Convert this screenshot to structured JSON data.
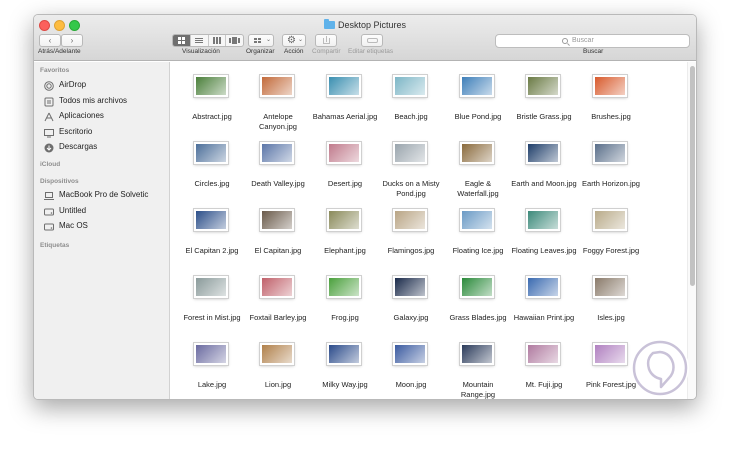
{
  "window": {
    "title": "Desktop Pictures",
    "nav_label": "Atrás/Adelante",
    "toolbar": {
      "view_label": "Visualización",
      "arrange_label": "Organizar",
      "action_label": "Acción",
      "share_label": "Compartir",
      "tags_label": "Editar etiquetas",
      "search_label": "Buscar",
      "search_placeholder": "Buscar"
    }
  },
  "sidebar": {
    "favorites_header": "Favoritos",
    "favorites": [
      {
        "label": "AirDrop",
        "icon": "airdrop-icon"
      },
      {
        "label": "Todos mis archivos",
        "icon": "all-files-icon"
      },
      {
        "label": "Aplicaciones",
        "icon": "applications-icon"
      },
      {
        "label": "Escritorio",
        "icon": "desktop-icon"
      },
      {
        "label": "Descargas",
        "icon": "downloads-icon"
      }
    ],
    "icloud_header": "iCloud",
    "devices_header": "Dispositivos",
    "devices": [
      {
        "label": "MacBook Pro de Solvetic",
        "icon": "laptop-icon"
      },
      {
        "label": "Untitled",
        "icon": "disk-icon"
      },
      {
        "label": "Mac OS",
        "icon": "disk-icon"
      }
    ],
    "tags_header": "Etiquetas"
  },
  "files": [
    {
      "name": "Abstract.jpg",
      "color": "#4a7f3a"
    },
    {
      "name": "Antelope Canyon.jpg",
      "color": "#c26a3a"
    },
    {
      "name": "Bahamas Aerial.jpg",
      "color": "#3a8fb0"
    },
    {
      "name": "Beach.jpg",
      "color": "#7db6c6"
    },
    {
      "name": "Blue Pond.jpg",
      "color": "#3e7fb9"
    },
    {
      "name": "Bristle Grass.jpg",
      "color": "#6a7a44"
    },
    {
      "name": "Brushes.jpg",
      "color": "#d85a2c"
    },
    {
      "name": "Circles.jpg",
      "color": "#4c6f9a"
    },
    {
      "name": "Death Valley.jpg",
      "color": "#5b76a8"
    },
    {
      "name": "Desert.jpg",
      "color": "#c07a8c"
    },
    {
      "name": "Ducks on a Misty Pond.jpg",
      "color": "#9aa5ad"
    },
    {
      "name": "Eagle & Waterfall.jpg",
      "color": "#8a6a3c"
    },
    {
      "name": "Earth and Moon.jpg",
      "color": "#1f3e6a"
    },
    {
      "name": "Earth Horizon.jpg",
      "color": "#5a6f8a"
    },
    {
      "name": "El Capitan 2.jpg",
      "color": "#2c4f8a"
    },
    {
      "name": "El Capitan.jpg",
      "color": "#6a5a4a"
    },
    {
      "name": "Elephant.jpg",
      "color": "#8a8a5a"
    },
    {
      "name": "Flamingos.jpg",
      "color": "#b9a585"
    },
    {
      "name": "Floating Ice.jpg",
      "color": "#6a9ac5"
    },
    {
      "name": "Floating Leaves.jpg",
      "color": "#3c8a7a"
    },
    {
      "name": "Foggy Forest.jpg",
      "color": "#b9ab8a"
    },
    {
      "name": "Forest in Mist.jpg",
      "color": "#8a9a9a"
    },
    {
      "name": "Foxtail Barley.jpg",
      "color": "#c0606a"
    },
    {
      "name": "Frog.jpg",
      "color": "#4aa03c"
    },
    {
      "name": "Galaxy.jpg",
      "color": "#1a2a4a"
    },
    {
      "name": "Grass Blades.jpg",
      "color": "#2a8a3a"
    },
    {
      "name": "Hawaiian Print.jpg",
      "color": "#3a6ab0"
    },
    {
      "name": "Isles.jpg",
      "color": "#8a7a6a"
    },
    {
      "name": "Lake.jpg",
      "color": "#6a6aa0"
    },
    {
      "name": "Lion.jpg",
      "color": "#b0804a"
    },
    {
      "name": "Milky Way.jpg",
      "color": "#2a4a8a"
    },
    {
      "name": "Moon.jpg",
      "color": "#3a5aa0"
    },
    {
      "name": "Mountain Range.jpg",
      "color": "#2a3a5a"
    },
    {
      "name": "Mt. Fuji.jpg",
      "color": "#b07aa0"
    },
    {
      "name": "Pink Forest.jpg",
      "color": "#b080c0"
    }
  ]
}
